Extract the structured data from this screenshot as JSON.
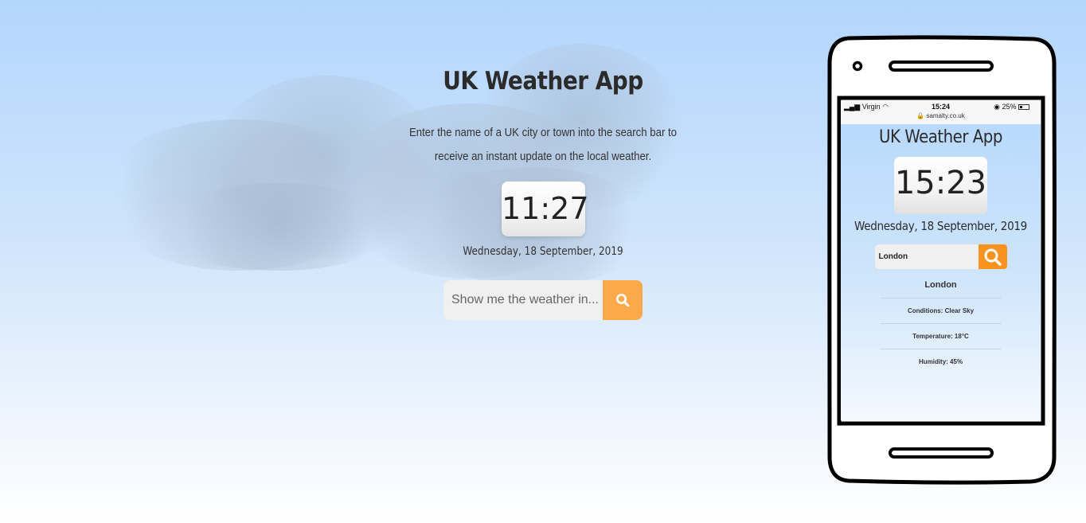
{
  "app": {
    "title": "UK Weather App",
    "intro": "Enter the name of a UK city or town into the search bar to receive an instant update on the local weather.",
    "time": "11:27",
    "date": "Wednesday, 18 September, 2019",
    "search": {
      "placeholder": "Show me the weather in...",
      "button_icon": "search-icon"
    }
  },
  "phone_preview": {
    "status_bar": {
      "carrier": "Virgin",
      "time": "15:24",
      "battery": "25%",
      "url": "samalty.co.uk"
    },
    "title": "UK Weather App",
    "time": "15:23",
    "date": "Wednesday, 18 September, 2019",
    "search_value": "London",
    "result": {
      "city": "London",
      "conditions": "Conditions: Clear Sky",
      "temperature": "Temperature: 18°C",
      "humidity": "Humidity: 45%"
    }
  },
  "colors": {
    "accent": "#fba94b",
    "phone_accent": "#f7931e",
    "sky_top": "#b3d6fd"
  }
}
